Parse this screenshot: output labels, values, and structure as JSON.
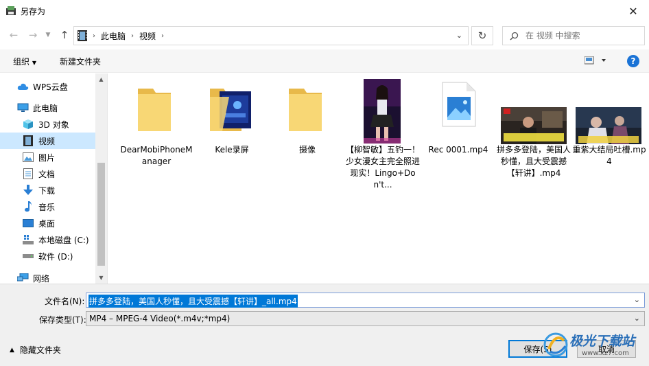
{
  "window": {
    "title": "另存为"
  },
  "address": {
    "crumbs": [
      "此电脑",
      "视频"
    ]
  },
  "search": {
    "placeholder": "在 视频 中搜索"
  },
  "toolbar": {
    "organize": "组织",
    "new_folder": "新建文件夹"
  },
  "sidebar": {
    "items": [
      {
        "label": "WPS云盘",
        "icon": "cloud-icon"
      },
      {
        "label": "此电脑",
        "icon": "computer-icon"
      },
      {
        "label": "3D 对象",
        "icon": "3d-objects-icon"
      },
      {
        "label": "视频",
        "icon": "video-icon",
        "selected": true
      },
      {
        "label": "图片",
        "icon": "pictures-icon"
      },
      {
        "label": "文档",
        "icon": "documents-icon"
      },
      {
        "label": "下载",
        "icon": "download-icon"
      },
      {
        "label": "音乐",
        "icon": "music-icon"
      },
      {
        "label": "桌面",
        "icon": "desktop-icon"
      },
      {
        "label": "本地磁盘 (C:)",
        "icon": "drive-c-icon"
      },
      {
        "label": "软件 (D:)",
        "icon": "drive-d-icon"
      },
      {
        "label": "网络",
        "icon": "network-icon"
      }
    ]
  },
  "files": [
    {
      "name": "DearMobiPhoneManager",
      "kind": "folder"
    },
    {
      "name": "Kele录屏",
      "kind": "folder-preview"
    },
    {
      "name": "摄像",
      "kind": "folder"
    },
    {
      "name": "【柳智敏】五钓一！少女漫女主完全照进现实！Lingo+Don't...",
      "kind": "video"
    },
    {
      "name": "Rec 0001.mp4",
      "kind": "image-file"
    },
    {
      "name": "拼多多登陆，美国人秒懂，且大受震撼【轩讲】.mp4",
      "kind": "video"
    },
    {
      "name": "重紫大结局吐槽.mp4",
      "kind": "video"
    }
  ],
  "form": {
    "filename_label": "文件名(N):",
    "filename_value": "拼多多登陆，美国人秒懂，且大受震撼【轩讲】_all.mp4",
    "filetype_label": "保存类型(T):",
    "filetype_value": "MP4 – MPEG-4 Video(*.m4v;*mp4)",
    "hide_folders": "隐藏文件夹",
    "save": "保存(S)",
    "cancel": "取消"
  },
  "watermark": {
    "text": "极光下载站",
    "url": "www.xz7.com"
  },
  "colors": {
    "accent": "#0078d7",
    "selection": "#cce8ff",
    "folder": "#f8d775"
  }
}
